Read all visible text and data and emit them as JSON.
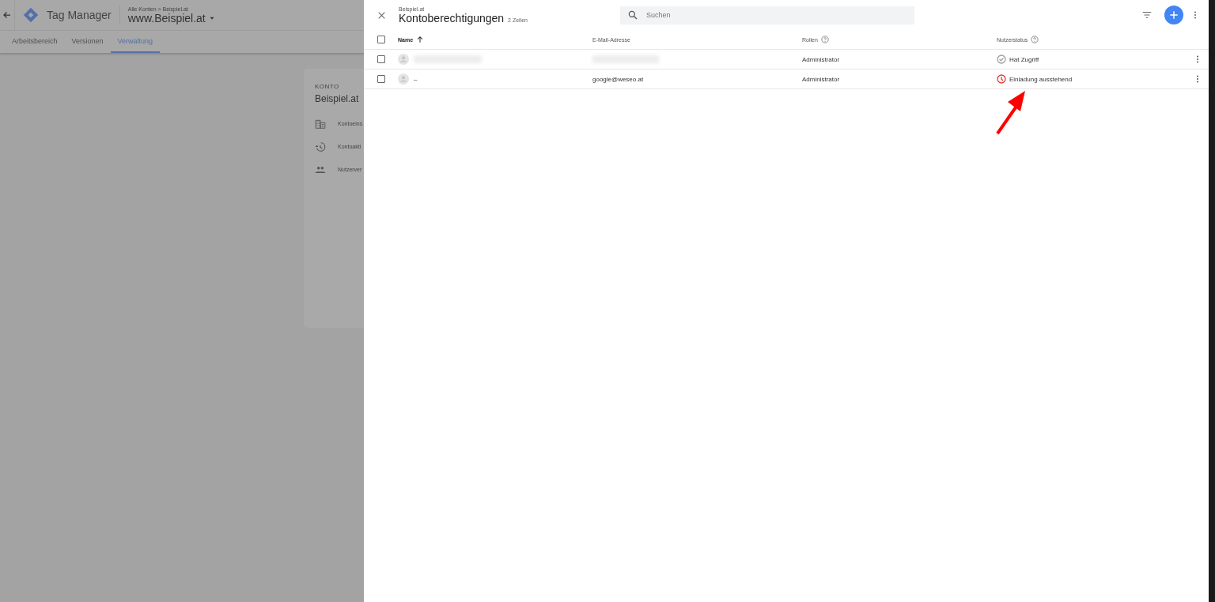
{
  "background_page": {
    "app_title": "Tag Manager",
    "breadcrumb": "Alle Konten > Beispiel.at",
    "container": "www.Beispiel.at",
    "tabs": [
      {
        "label": "Arbeitsbereich",
        "selected": false
      },
      {
        "label": "Versionen",
        "selected": false
      },
      {
        "label": "Verwaltung",
        "selected": true
      }
    ],
    "card": {
      "section": "KONTO",
      "title": "Beispiel.at",
      "items": [
        {
          "kind": "building",
          "label": "Kontoeins"
        },
        {
          "kind": "history",
          "label": "Kontoakti"
        },
        {
          "kind": "people",
          "label": "Nutzerver"
        }
      ]
    }
  },
  "panel": {
    "breadcrumb": "Beispiel.at",
    "title": "Kontoberechtigungen",
    "row_count": "2 Zeilen",
    "search": {
      "placeholder": "Suchen"
    },
    "table": {
      "select_all": {
        "checked": false
      },
      "columns": [
        {
          "label": "Name",
          "sorted": true,
          "help": false
        },
        {
          "label": "E-Mail-Adresse",
          "sorted": false,
          "help": false
        },
        {
          "label": "Rollen",
          "sorted": false,
          "help": true
        },
        {
          "label": "Nutzerstatus",
          "sorted": false,
          "help": true
        }
      ],
      "rows": [
        {
          "checked": false,
          "redacted": true,
          "role": "Administrator",
          "status": "Hat Zugriff",
          "kind": "access",
          "color": "#9e9e9e"
        },
        {
          "checked": false,
          "redacted": false,
          "name": "–",
          "email": "google@weseo.at",
          "role": "Administrator",
          "status": "Einladung ausstehend",
          "kind": "pending",
          "color": "#e53935"
        }
      ]
    }
  }
}
